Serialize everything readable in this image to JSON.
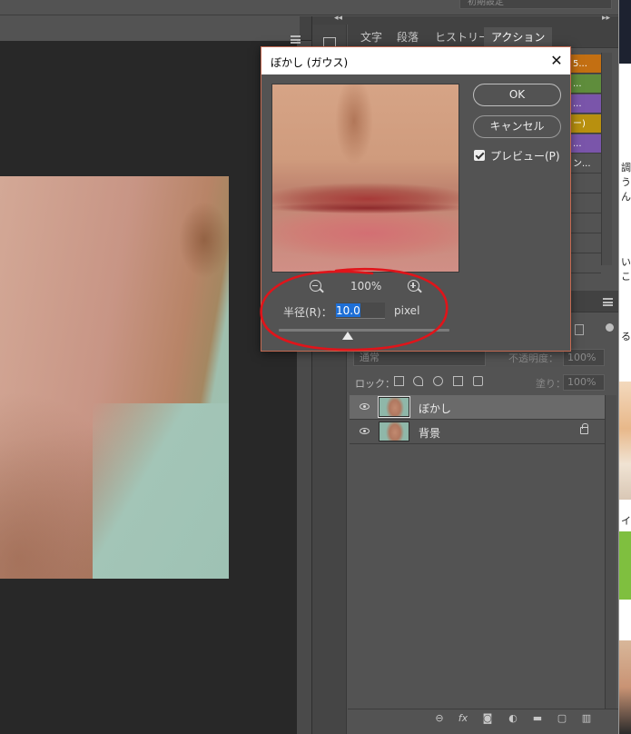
{
  "topbar": {
    "preset_label": "初期設定"
  },
  "panel_tabs": [
    {
      "label": "文字"
    },
    {
      "label": "段落"
    },
    {
      "label": "ヒストリー"
    },
    {
      "label": "アクション"
    }
  ],
  "actions": [
    {
      "label": "5...",
      "color": "#c36f12"
    },
    {
      "label": "...",
      "color": "#5f8d3c"
    },
    {
      "label": "...",
      "color": "#7a55aa"
    },
    {
      "label": "ー)",
      "color": "#b8900f"
    },
    {
      "label": "...",
      "color": "#7a55aa"
    },
    {
      "label": "ン...",
      "color": "#535353"
    },
    {
      "label": "",
      "color": "#535353"
    },
    {
      "label": "",
      "color": "#535353"
    },
    {
      "label": "",
      "color": "#535353"
    },
    {
      "label": "",
      "color": "#535353"
    },
    {
      "label": "",
      "color": "#535353"
    }
  ],
  "layers_panel": {
    "blend_mode": "通常",
    "opacity_label": "不透明度：",
    "opacity_value": "100%",
    "lock_label": "ロック：",
    "fill_label": "塗り：",
    "fill_value": "100%",
    "layers": [
      {
        "name": "ぼかし",
        "selected": true,
        "locked": false
      },
      {
        "name": "背景",
        "selected": false,
        "locked": true
      }
    ],
    "bottom_icons": [
      "link-icon",
      "fx-icon",
      "mask-icon",
      "adjustment-icon",
      "folder-icon",
      "new-layer-icon",
      "trash-icon"
    ]
  },
  "dialog": {
    "title": "ぼかし (ガウス)",
    "close_glyph": "✕",
    "ok_label": "OK",
    "cancel_label": "キャンセル",
    "preview_label": "プレビュー(P)",
    "preview_checked": true,
    "zoom_level": "100%",
    "radius_label": "半径(R)：",
    "radius_value": "10.0",
    "radius_unit": "pixel"
  },
  "web_strip": {
    "texts": [
      "調",
      "う",
      "ん",
      "い",
      "こ",
      "る",
      "イ"
    ]
  },
  "colors": {
    "panel_bg": "#535353",
    "dark_bg": "#282828",
    "dialog_border": "#c46a52",
    "annotation": "#e0141a",
    "selection": "#1e6fd6"
  }
}
